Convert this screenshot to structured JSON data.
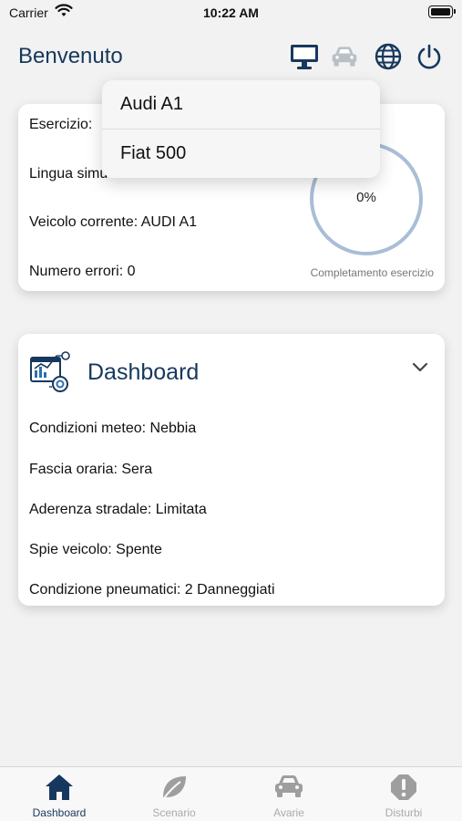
{
  "status_bar": {
    "carrier": "Carrier",
    "time": "10:22 AM"
  },
  "header": {
    "title": "Benvenuto",
    "icons": [
      "monitor-icon",
      "car-icon",
      "globe-icon",
      "power-icon"
    ]
  },
  "summary_card": {
    "exercise_label": "Esercizio:",
    "language_label": "Lingua simu",
    "vehicle_line": "Veicolo corrente: AUDI A1",
    "errors_line": "Numero errori: 0",
    "progress_text": "0%",
    "progress_value": 0,
    "progress_caption": "Completamento esercizio"
  },
  "vehicle_menu": {
    "items": [
      "Audi A1",
      "Fiat 500"
    ]
  },
  "dashboard_card": {
    "title": "Dashboard",
    "rows": [
      "Condizioni meteo: Nebbia",
      "Fascia oraria: Sera",
      "Aderenza stradale: Limitata",
      "Spie veicolo: Spente",
      "Condizione pneumatici: 2 Danneggiati"
    ]
  },
  "tabbar": {
    "tabs": [
      {
        "label": "Dashboard",
        "icon": "home-icon",
        "active": true
      },
      {
        "label": "Scenario",
        "icon": "leaf-icon",
        "active": false
      },
      {
        "label": "Avarie",
        "icon": "car-icon",
        "active": false
      },
      {
        "label": "Disturbi",
        "icon": "alert-icon",
        "active": false
      }
    ]
  },
  "colors": {
    "accent": "#17385e",
    "ring_track": "#a9bed6",
    "inactive": "#aaaaaa"
  }
}
